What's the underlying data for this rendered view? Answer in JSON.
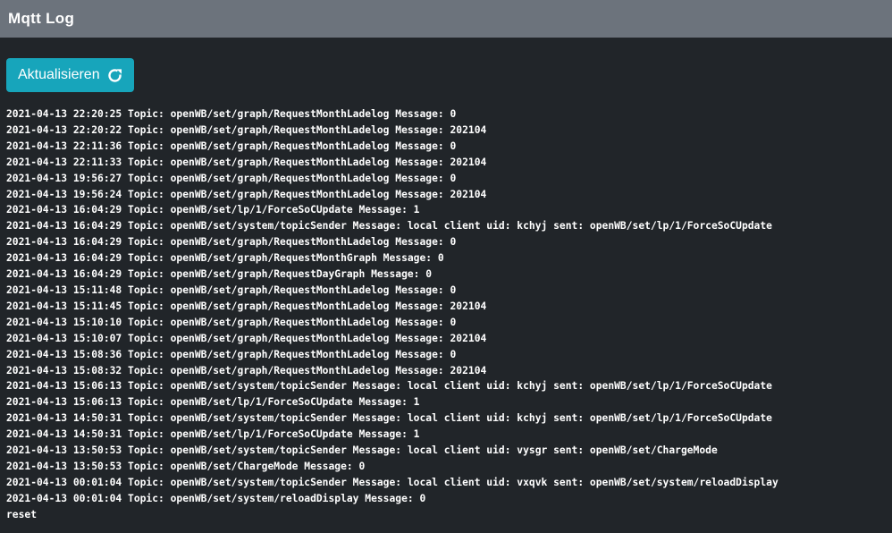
{
  "header": {
    "title": "Mqtt Log"
  },
  "toolbar": {
    "refresh_label": "Aktualisieren",
    "refresh_icon": "refresh-icon"
  },
  "colors": {
    "header_bg": "#6c737c",
    "page_bg": "#212529",
    "accent_button": "#17a5bb",
    "text": "#ffffff"
  },
  "log": {
    "lines": [
      "2021-04-13 22:20:25 Topic: openWB/set/graph/RequestMonthLadelog Message: 0",
      "2021-04-13 22:20:22 Topic: openWB/set/graph/RequestMonthLadelog Message: 202104",
      "2021-04-13 22:11:36 Topic: openWB/set/graph/RequestMonthLadelog Message: 0",
      "2021-04-13 22:11:33 Topic: openWB/set/graph/RequestMonthLadelog Message: 202104",
      "2021-04-13 19:56:27 Topic: openWB/set/graph/RequestMonthLadelog Message: 0",
      "2021-04-13 19:56:24 Topic: openWB/set/graph/RequestMonthLadelog Message: 202104",
      "2021-04-13 16:04:29 Topic: openWB/set/lp/1/ForceSoCUpdate Message: 1",
      "2021-04-13 16:04:29 Topic: openWB/set/system/topicSender Message: local client uid: kchyj sent: openWB/set/lp/1/ForceSoCUpdate",
      "2021-04-13 16:04:29 Topic: openWB/set/graph/RequestMonthLadelog Message: 0",
      "2021-04-13 16:04:29 Topic: openWB/set/graph/RequestMonthGraph Message: 0",
      "2021-04-13 16:04:29 Topic: openWB/set/graph/RequestDayGraph Message: 0",
      "2021-04-13 15:11:48 Topic: openWB/set/graph/RequestMonthLadelog Message: 0",
      "2021-04-13 15:11:45 Topic: openWB/set/graph/RequestMonthLadelog Message: 202104",
      "2021-04-13 15:10:10 Topic: openWB/set/graph/RequestMonthLadelog Message: 0",
      "2021-04-13 15:10:07 Topic: openWB/set/graph/RequestMonthLadelog Message: 202104",
      "2021-04-13 15:08:36 Topic: openWB/set/graph/RequestMonthLadelog Message: 0",
      "2021-04-13 15:08:32 Topic: openWB/set/graph/RequestMonthLadelog Message: 202104",
      "2021-04-13 15:06:13 Topic: openWB/set/system/topicSender Message: local client uid: kchyj sent: openWB/set/lp/1/ForceSoCUpdate",
      "2021-04-13 15:06:13 Topic: openWB/set/lp/1/ForceSoCUpdate Message: 1",
      "2021-04-13 14:50:31 Topic: openWB/set/system/topicSender Message: local client uid: kchyj sent: openWB/set/lp/1/ForceSoCUpdate",
      "2021-04-13 14:50:31 Topic: openWB/set/lp/1/ForceSoCUpdate Message: 1",
      "2021-04-13 13:50:53 Topic: openWB/set/system/topicSender Message: local client uid: vysgr sent: openWB/set/ChargeMode",
      "2021-04-13 13:50:53 Topic: openWB/set/ChargeMode Message: 0",
      "2021-04-13 00:01:04 Topic: openWB/set/system/topicSender Message: local client uid: vxqvk sent: openWB/set/system/reloadDisplay",
      "2021-04-13 00:01:04 Topic: openWB/set/system/reloadDisplay Message: 0",
      "reset"
    ]
  }
}
